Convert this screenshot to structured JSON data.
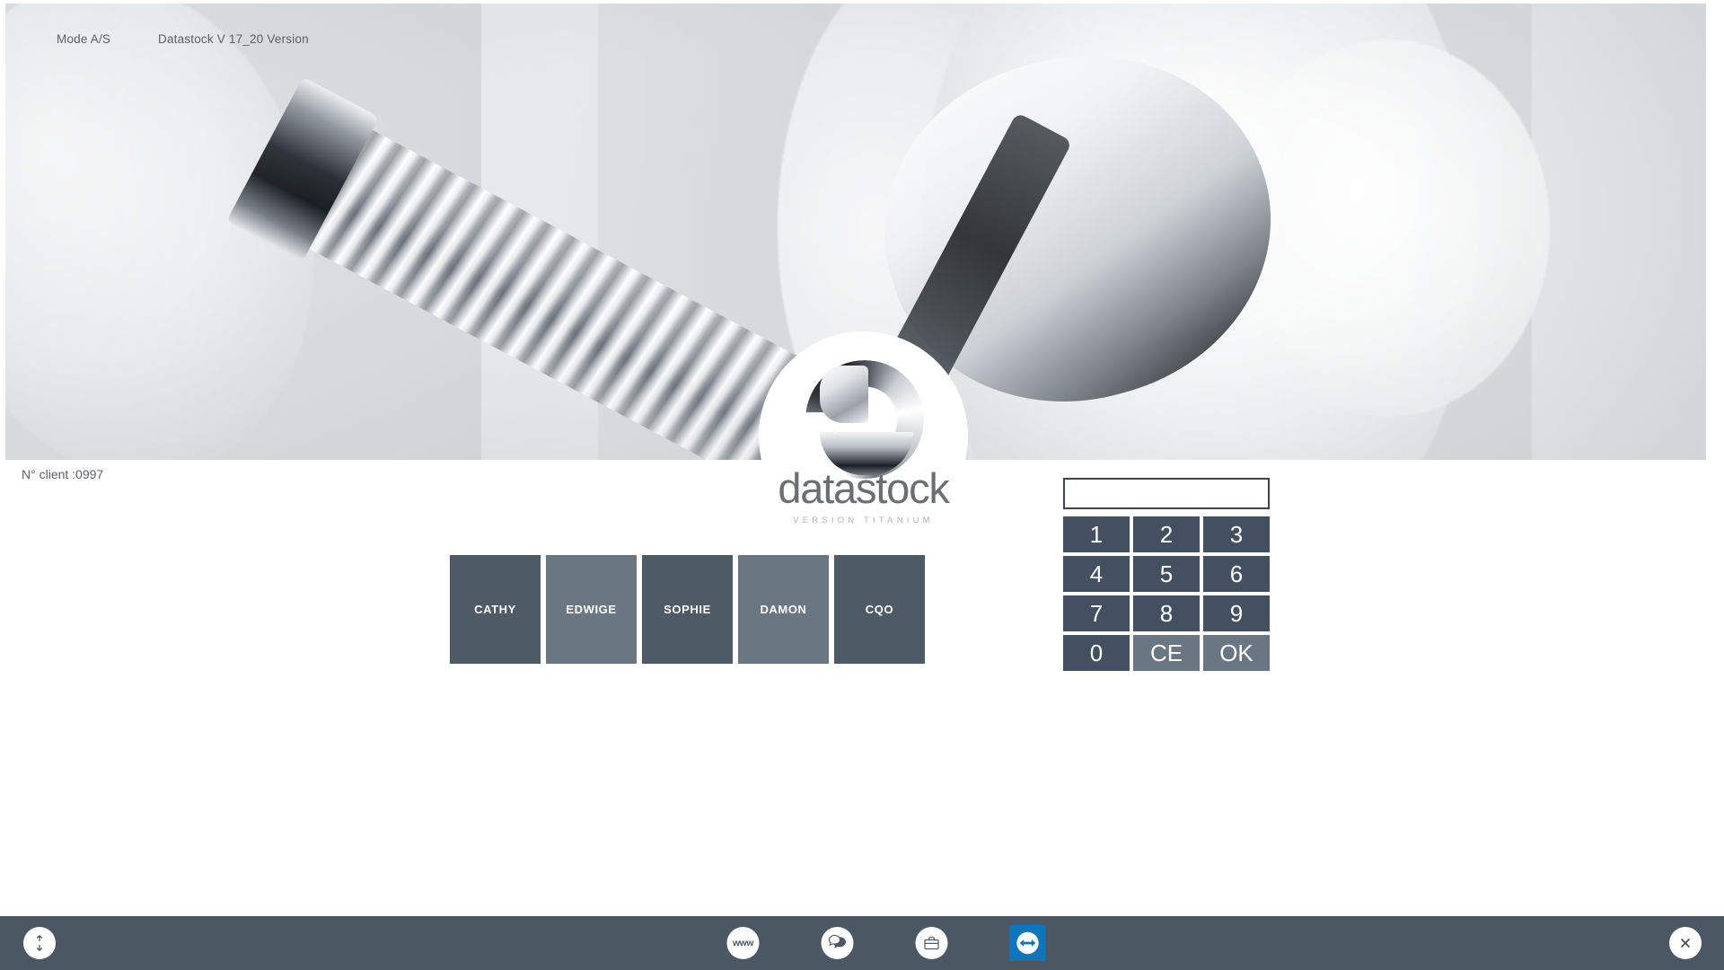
{
  "hero": {
    "mode_label": "Mode A/S",
    "version_label": "Datastock V 17_20 Version",
    "alt": "chrome dental implant screws grayscale render"
  },
  "logo": {
    "wordmark": "datastock",
    "tagline": "VERSION TITANIUM",
    "mark_icon": "datastock-chrome-d-icon"
  },
  "client": {
    "label": "N° client :0997"
  },
  "users": {
    "buttons": [
      {
        "label": "CATHY",
        "color": "#4e5a66"
      },
      {
        "label": "EDWIGE",
        "color": "#6b7683"
      },
      {
        "label": "SOPHIE",
        "color": "#4e5a66"
      },
      {
        "label": "DAMON",
        "color": "#6b7683"
      },
      {
        "label": "CQO",
        "color": "#4e5a66"
      }
    ]
  },
  "keypad": {
    "display_value": "",
    "display_placeholder": "",
    "keys": [
      {
        "label": "1",
        "kind": "digit",
        "name": "key-1"
      },
      {
        "label": "2",
        "kind": "digit",
        "name": "key-2"
      },
      {
        "label": "3",
        "kind": "digit",
        "name": "key-3"
      },
      {
        "label": "4",
        "kind": "digit",
        "name": "key-4"
      },
      {
        "label": "5",
        "kind": "digit",
        "name": "key-5"
      },
      {
        "label": "6",
        "kind": "digit",
        "name": "key-6"
      },
      {
        "label": "7",
        "kind": "digit",
        "name": "key-7"
      },
      {
        "label": "8",
        "kind": "digit",
        "name": "key-8"
      },
      {
        "label": "9",
        "kind": "digit",
        "name": "key-9"
      },
      {
        "label": "0",
        "kind": "digit",
        "name": "key-0"
      },
      {
        "label": "CE",
        "kind": "action",
        "name": "key-clear-entry"
      },
      {
        "label": "OK",
        "kind": "action",
        "name": "key-ok"
      }
    ],
    "digit_color": "#42505f",
    "action_color": "#6a7682"
  },
  "taskbar": {
    "background": "#4c5764",
    "scroll_icon": "up-down-arrows-icon",
    "items": [
      {
        "name": "www-icon",
        "label": "www"
      },
      {
        "name": "chat-bubble-icon",
        "label": ""
      },
      {
        "name": "briefcase-icon",
        "label": ""
      },
      {
        "name": "teamviewer-icon",
        "label": ""
      }
    ],
    "teamviewer_color": "#0e75bc",
    "close_icon": "close-x-icon"
  }
}
